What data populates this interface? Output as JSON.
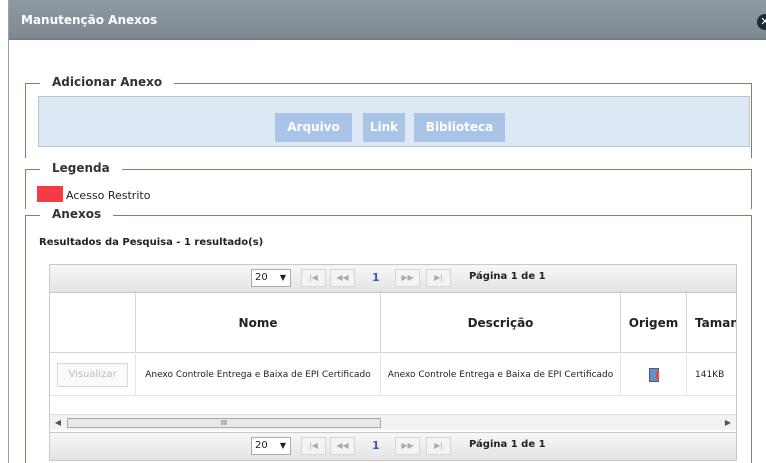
{
  "dialog": {
    "title": "Manutenção Anexos",
    "close_icon": "close-icon",
    "close_glyph": "✕"
  },
  "add_section": {
    "legend": "Adicionar Anexo",
    "buttons": [
      "Arquivo",
      "Link",
      "Biblioteca"
    ]
  },
  "legend_section": {
    "legend": "Legenda",
    "swatch_color": "#f63b45",
    "item_label": "Acesso Restrito"
  },
  "attachments": {
    "legend": "Anexos",
    "results_text": "Resultados da Pesquisa - 1 resultado(s)",
    "pager": {
      "page_size": "20",
      "current_page": "1",
      "page_info": "Página 1 de 1",
      "first_glyph": "|◀",
      "prev_glyph": "◀◀",
      "next_glyph": "▶▶",
      "last_glyph": "▶|"
    },
    "columns": [
      "",
      "Nome",
      "Descrição",
      "Origem",
      "Tamanh"
    ],
    "rows": [
      {
        "action": "Visualizar",
        "nome": "Anexo Controle Entrega e Baixa de EPI Certificado",
        "descricao": "Anexo Controle Entrega e Baixa de EPI Certificado",
        "origem_icon": "document-icon",
        "tamanho": "141KB"
      }
    ],
    "scrollbar": {
      "left_glyph": "◀",
      "right_glyph": "▶",
      "thumb_grip": "III"
    }
  }
}
